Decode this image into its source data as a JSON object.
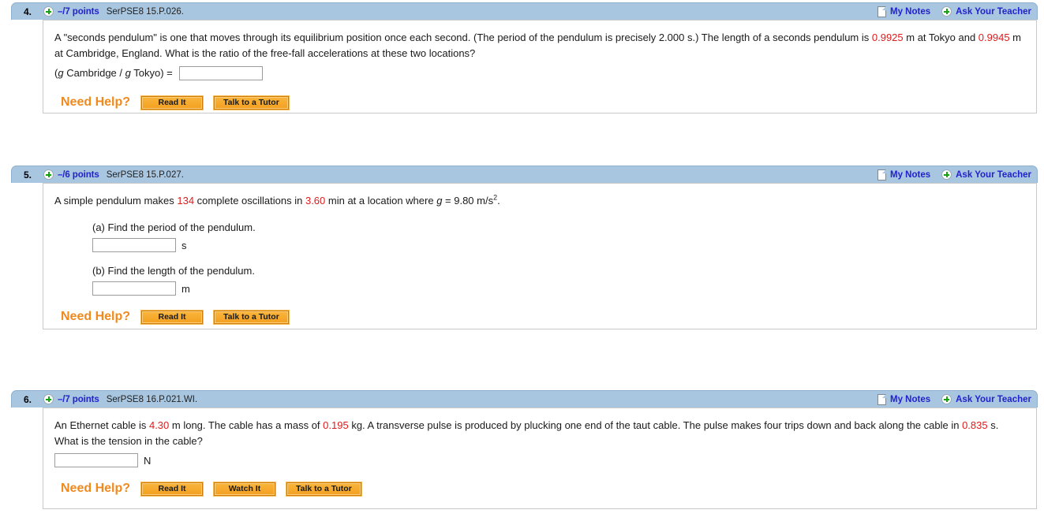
{
  "header_links": {
    "my_notes": "My Notes",
    "ask_your_teacher": "Ask Your Teacher"
  },
  "help": {
    "label": "Need Help?",
    "read_it": "Read It",
    "watch_it": "Watch It",
    "talk_to_a_tutor": "Talk to a Tutor"
  },
  "questions": [
    {
      "number": "4.",
      "points": "–/7 points",
      "code": "SerPSE8 15.P.026.",
      "text_line1_a": "A \"seconds pendulum\" is one that moves through its equilibrium position once each second. (The period of the pendulum is precisely 2.000 s.) The length of a seconds pendulum is ",
      "value1": "0.9925",
      "text_mid1": " m at Tokyo and ",
      "value2": "0.9945",
      "text_mid2": " m at Cambridge, England. What is the ratio of the free-fall accelerations at these two locations?",
      "ratio_prefix_open": "(",
      "ratio_g1": "g",
      "ratio_cambridge": " Cambridge / ",
      "ratio_g2": "g",
      "ratio_tokyo": " Tokyo) =",
      "input_value": "",
      "help_buttons": [
        "Read It",
        "Talk to a Tutor"
      ]
    },
    {
      "number": "5.",
      "points": "–/6 points",
      "code": "SerPSE8 15.P.027.",
      "text_a": "A simple pendulum makes ",
      "value1": "134",
      "text_b": " complete oscillations in ",
      "value2": "3.60",
      "text_c": " min at a location where ",
      "italic_g": "g",
      "text_d": " = 9.80 m/s",
      "exponent": "2",
      "text_e": ".",
      "parts": [
        {
          "label": "(a) Find the period of the pendulum.",
          "unit": "s",
          "input_value": ""
        },
        {
          "label": "(b) Find the length of the pendulum.",
          "unit": "m",
          "input_value": ""
        }
      ],
      "help_buttons": [
        "Read It",
        "Talk to a Tutor"
      ]
    },
    {
      "number": "6.",
      "points": "–/7 points",
      "code": "SerPSE8 16.P.021.WI.",
      "text_a": "An Ethernet cable is ",
      "value1": "4.30",
      "text_b": " m long. The cable has a mass of ",
      "value2": "0.195",
      "text_c": " kg. A transverse pulse is produced by plucking one end of the taut cable. The pulse makes four trips down and back along the cable in ",
      "value3": "0.835",
      "text_d": " s. What is the tension in the cable?",
      "unit": "N",
      "input_value": "",
      "help_buttons": [
        "Read It",
        "Watch It",
        "Talk to a Tutor"
      ]
    }
  ],
  "colors": {
    "header_bg": "#a8c6e0",
    "link_blue": "#2222cc",
    "value_red": "#e01b1b",
    "help_orange": "#f08a1e",
    "button_gold": "#f3a020"
  }
}
